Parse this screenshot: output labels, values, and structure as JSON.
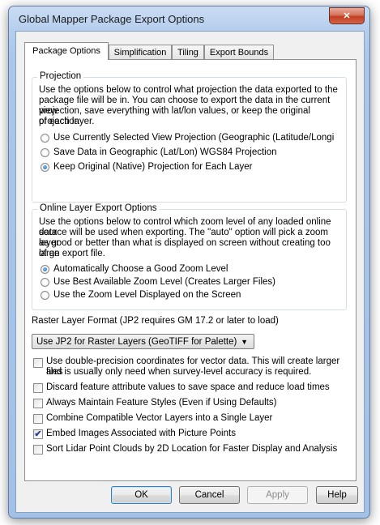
{
  "window": {
    "title": "Global Mapper Package Export Options",
    "close_glyph": "✕"
  },
  "tabs": [
    {
      "label": "Package Options",
      "active": true
    },
    {
      "label": "Simplification",
      "active": false
    },
    {
      "label": "Tiling",
      "active": false
    },
    {
      "label": "Export Bounds",
      "active": false
    }
  ],
  "projection": {
    "legend": "Projection",
    "description_lines": [
      "Use the options below to control what projection the data exported to the",
      "package file will be in. You can choose to export the data in the current view",
      "projection, save everything with lat/lon values, or keep the original projection",
      "of each layer."
    ],
    "options": [
      {
        "label": "Use Currently Selected View Projection (Geographic (Latitude/Longi",
        "selected": false
      },
      {
        "label": "Save Data in Geographic (Lat/Lon) WGS84 Projection",
        "selected": false
      },
      {
        "label": "Keep Original (Native) Projection for Each Layer",
        "selected": true
      }
    ]
  },
  "online_layer": {
    "legend": "Online Layer Export Options",
    "description_lines": [
      "Use the options below to control which zoom level of any loaded online data",
      "source will be used when exporting. The \"auto\" option will pick a zoom layer",
      "as good or better than what is displayed on screen without creating too large",
      "of an export file."
    ],
    "options": [
      {
        "label": "Automatically Choose a Good Zoom Level",
        "selected": true
      },
      {
        "label": "Use Best Available Zoom Level (Creates Larger Files)",
        "selected": false
      },
      {
        "label": "Use the Zoom Level Displayed on the Screen",
        "selected": false
      }
    ]
  },
  "raster": {
    "label": "Raster Layer Format (JP2 requires GM 17.2 or later to load)",
    "selected_value": "Use JP2 for Raster Layers (GeoTIFF for Palette)",
    "arrow_glyph": "▼"
  },
  "checkboxes": [
    {
      "lines": [
        "Use double-precision coordinates for vector data. This will create larger files",
        "and is usually only need when survey-level accuracy is required."
      ],
      "checked": false
    },
    {
      "lines": [
        "Discard feature attribute values to save space and reduce load times"
      ],
      "checked": false
    },
    {
      "lines": [
        "Always Maintain Feature Styles (Even if Using Defaults)"
      ],
      "checked": false
    },
    {
      "lines": [
        "Combine Compatible Vector Layers into a Single Layer"
      ],
      "checked": false
    },
    {
      "lines": [
        "Embed Images Associated with Picture Points"
      ],
      "checked": true
    },
    {
      "lines": [
        "Sort Lidar Point Clouds by 2D Location for Faster Display and Analysis"
      ],
      "checked": false
    }
  ],
  "check_glyph": "✔",
  "buttons": {
    "ok": "OK",
    "cancel": "Cancel",
    "apply": "Apply",
    "help": "Help"
  },
  "colors": {
    "close_button": "#c94a2f",
    "title_bar": "#b7cfee",
    "radio_dot": "#1d5fa9"
  }
}
